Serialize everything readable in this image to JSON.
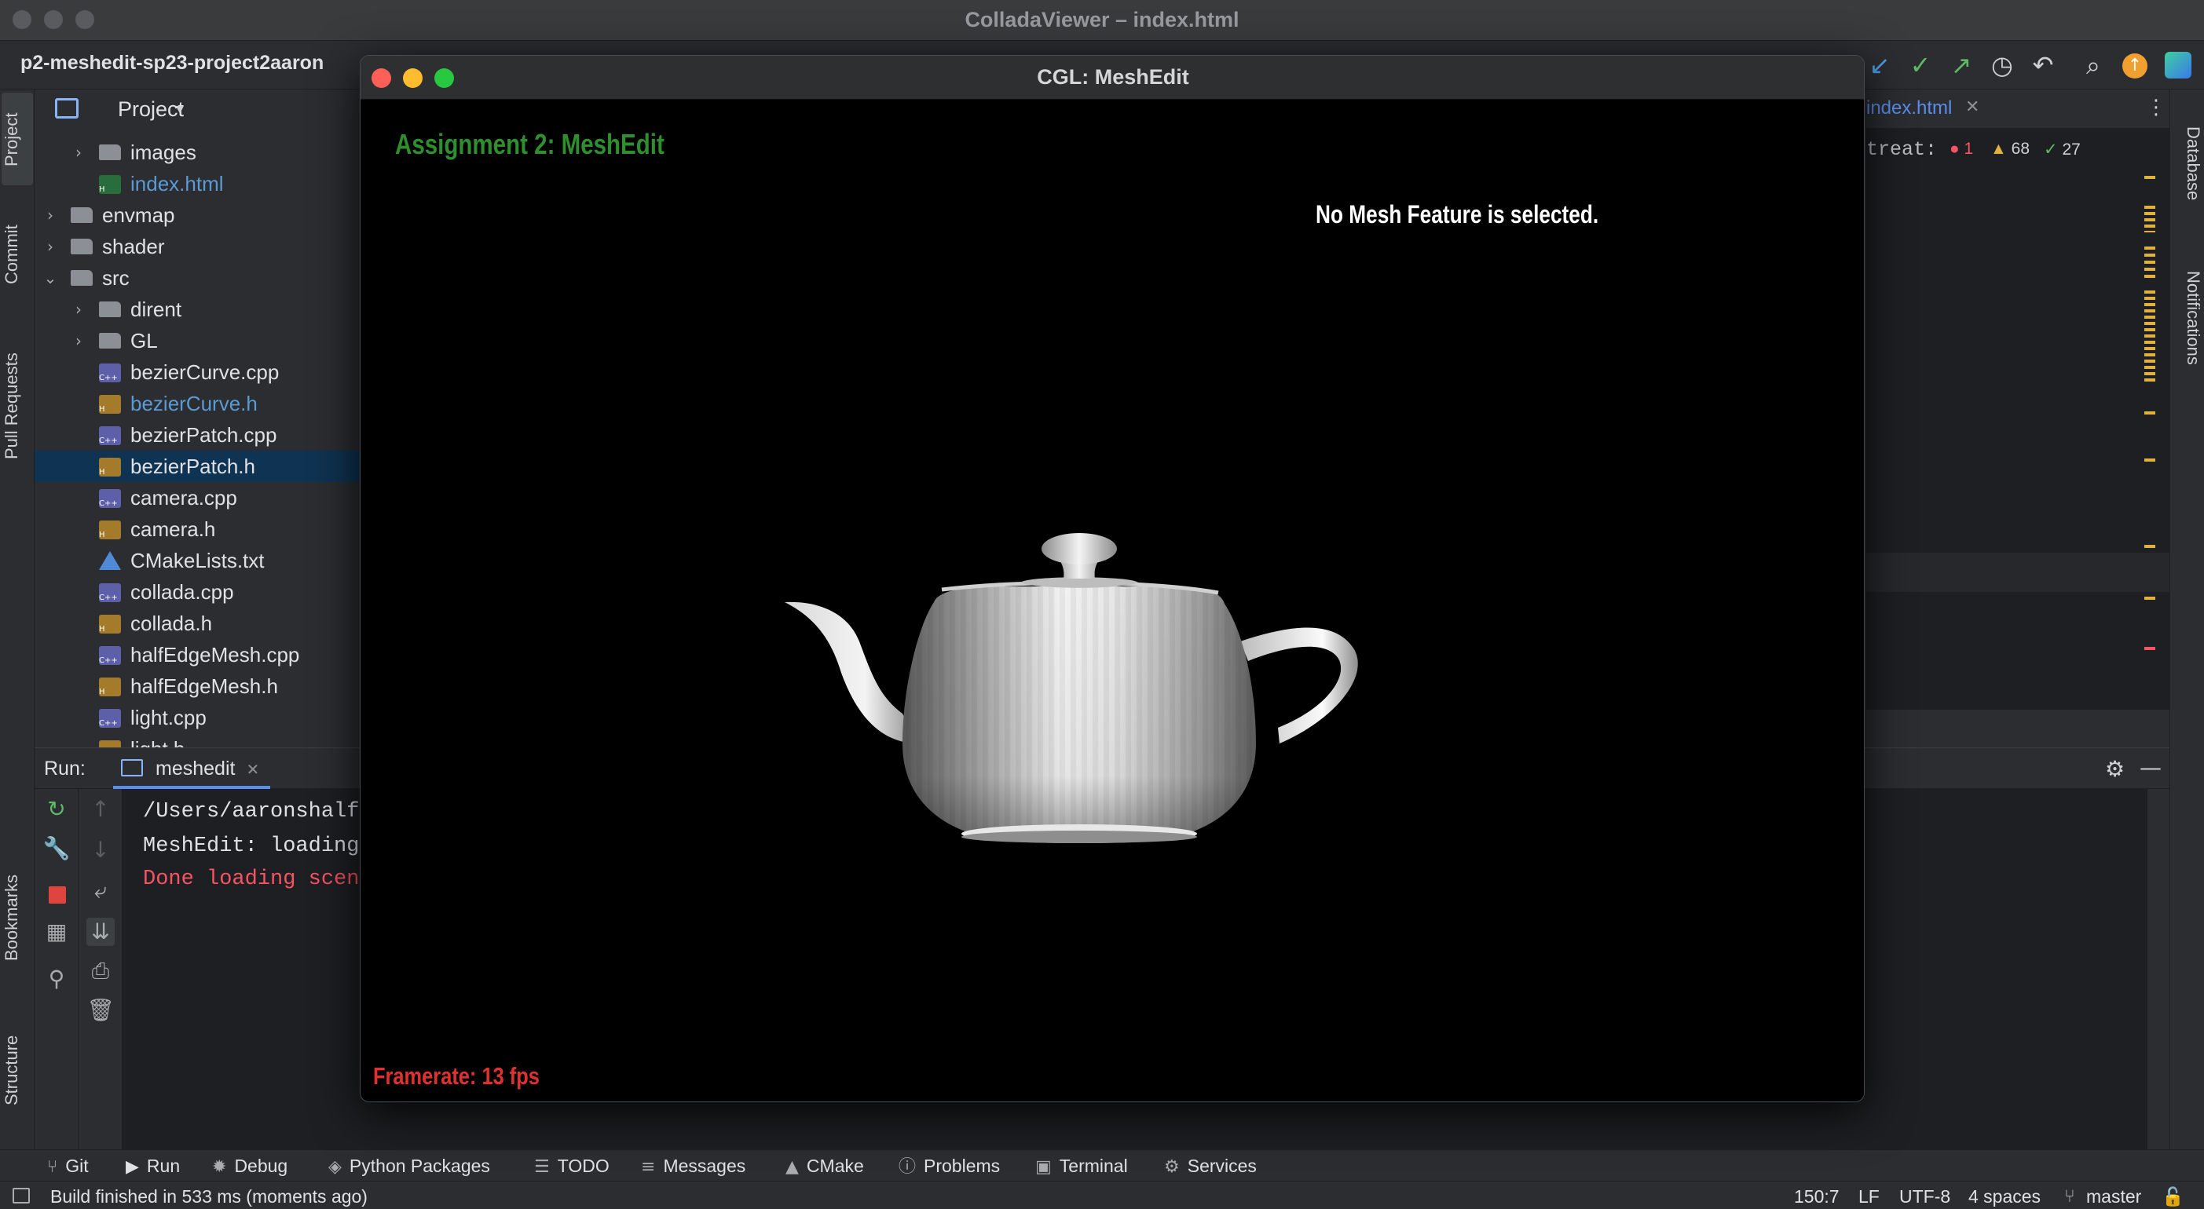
{
  "ide": {
    "window_title": "ColladaViewer – index.html",
    "project_name": "p2-meshedit-sp23-project2aaron",
    "left_tabs": [
      "Project",
      "Commit",
      "Pull Requests",
      "Bookmarks",
      "Structure"
    ],
    "right_tabs": [
      "Database",
      "Notifications"
    ],
    "editor_tab": "index.html",
    "editor_snippet": "treat:",
    "inspections": {
      "errors": "1",
      "warnings": "68",
      "ok": "27"
    }
  },
  "project_panel": {
    "header": "Project",
    "tree": [
      {
        "name": "images",
        "type": "folder",
        "depth": 2,
        "expandable": true,
        "expanded": false
      },
      {
        "name": "index.html",
        "type": "html",
        "depth": 2,
        "expandable": false
      },
      {
        "name": "envmap",
        "type": "folder",
        "depth": 1,
        "expandable": true,
        "expanded": false
      },
      {
        "name": "shader",
        "type": "folder",
        "depth": 1,
        "expandable": true,
        "expanded": false
      },
      {
        "name": "src",
        "type": "folder",
        "depth": 1,
        "expandable": true,
        "expanded": true
      },
      {
        "name": "dirent",
        "type": "folder",
        "depth": 2,
        "expandable": true,
        "expanded": false
      },
      {
        "name": "GL",
        "type": "folder",
        "depth": 2,
        "expandable": true,
        "expanded": false
      },
      {
        "name": "bezierCurve.cpp",
        "type": "cpp",
        "depth": 2
      },
      {
        "name": "bezierCurve.h",
        "type": "h",
        "depth": 2,
        "modified": true
      },
      {
        "name": "bezierPatch.cpp",
        "type": "cpp",
        "depth": 2
      },
      {
        "name": "bezierPatch.h",
        "type": "h",
        "depth": 2,
        "selected": true
      },
      {
        "name": "camera.cpp",
        "type": "cpp",
        "depth": 2
      },
      {
        "name": "camera.h",
        "type": "h",
        "depth": 2
      },
      {
        "name": "CMakeLists.txt",
        "type": "cmake",
        "depth": 2
      },
      {
        "name": "collada.cpp",
        "type": "cpp",
        "depth": 2
      },
      {
        "name": "collada.h",
        "type": "h",
        "depth": 2
      },
      {
        "name": "halfEdgeMesh.cpp",
        "type": "cpp",
        "depth": 2
      },
      {
        "name": "halfEdgeMesh.h",
        "type": "h",
        "depth": 2
      },
      {
        "name": "light.cpp",
        "type": "cpp",
        "depth": 2
      },
      {
        "name": "light.h",
        "type": "h",
        "depth": 2
      }
    ]
  },
  "run_panel": {
    "label": "Run:",
    "tab": "meshedit",
    "console": [
      {
        "text": "/Users/aaronshalf",
        "color": "#dfe1e5"
      },
      {
        "text": "MeshEdit: loading",
        "color": "#dfe1e5"
      },
      {
        "text": "Done loading scen",
        "color": "#f75464"
      }
    ]
  },
  "bottom_tools": [
    {
      "icon": "⑂",
      "label": "Git"
    },
    {
      "icon": "▶",
      "label": "Run"
    },
    {
      "icon": "✹",
      "label": "Debug"
    },
    {
      "icon": "◈",
      "label": "Python Packages"
    },
    {
      "icon": "☰",
      "label": "TODO"
    },
    {
      "icon": "≡",
      "label": "Messages"
    },
    {
      "icon": "▲",
      "label": "CMake"
    },
    {
      "icon": "ⓘ",
      "label": "Problems"
    },
    {
      "icon": "▣",
      "label": "Terminal"
    },
    {
      "icon": "⚙",
      "label": "Services"
    }
  ],
  "status_bar": {
    "message": "Build finished in 533 ms (moments ago)",
    "position": "150:7",
    "line_sep": "LF",
    "encoding": "UTF-8",
    "indent": "4 spaces",
    "branch": "master"
  },
  "cgl_window": {
    "title": "CGL: MeshEdit",
    "assignment_title": "Assignment 2: MeshEdit",
    "selection_status": "No Mesh Feature is selected.",
    "framerate": "Framerate: 13 fps"
  },
  "colors": {
    "assignment_title": "#2f8f2f",
    "framerate": "#e03030",
    "selection_bg": "#0f3352",
    "accent_blue": "#5b8def"
  }
}
